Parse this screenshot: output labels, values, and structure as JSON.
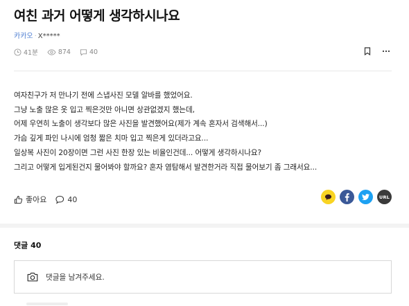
{
  "article": {
    "title": "여친 과거 어떻게 생각하시나요",
    "category": "카카오",
    "author": "X*****",
    "time": "41분",
    "views": "874",
    "comments_count": "40"
  },
  "body": {
    "lines": [
      "여자친구가 저 만나기 전에 스냅사진 모델 알바를 했었어요.",
      "그냥 노출 많은 옷 입고 찍은것만 아니면 상관없겠지 했는데,",
      "어제 우연히 노출이 생각보다 많은 사진을 발견했어요(제가 계속 혼자서 검색해서...)",
      "가슴 깊게 파인 나시에 엄청 짧은 치마 입고 찍은게 있더라고요...",
      "일상복 사진이 20장이면 그런 사진 한장 있는 비율인건데... 어떻게 생각하시나요?",
      "그리고 어떻게 입게된건지 물어봐야 할까요? 혼자 염탐해서 발견한거라 직접 물어보기 좀 그래서요..."
    ]
  },
  "actions": {
    "like_label": "좋아요",
    "comment_count": "40"
  },
  "share": {
    "url_label": "URL",
    "colors": {
      "kakao": "#f9d423",
      "facebook": "#3b5998",
      "twitter": "#1da1f2",
      "url": "#3a3a3a"
    }
  },
  "comments": {
    "heading": "댓글 40",
    "placeholder": "댓글을 남겨주세요."
  },
  "icons": [
    "clock-icon",
    "eye-icon",
    "comment-icon",
    "bookmark-icon",
    "more-icon",
    "thumbs-up-icon",
    "speech-bubble-icon",
    "kakao-share-icon",
    "facebook-icon",
    "twitter-icon",
    "url-link-icon",
    "camera-icon"
  ]
}
